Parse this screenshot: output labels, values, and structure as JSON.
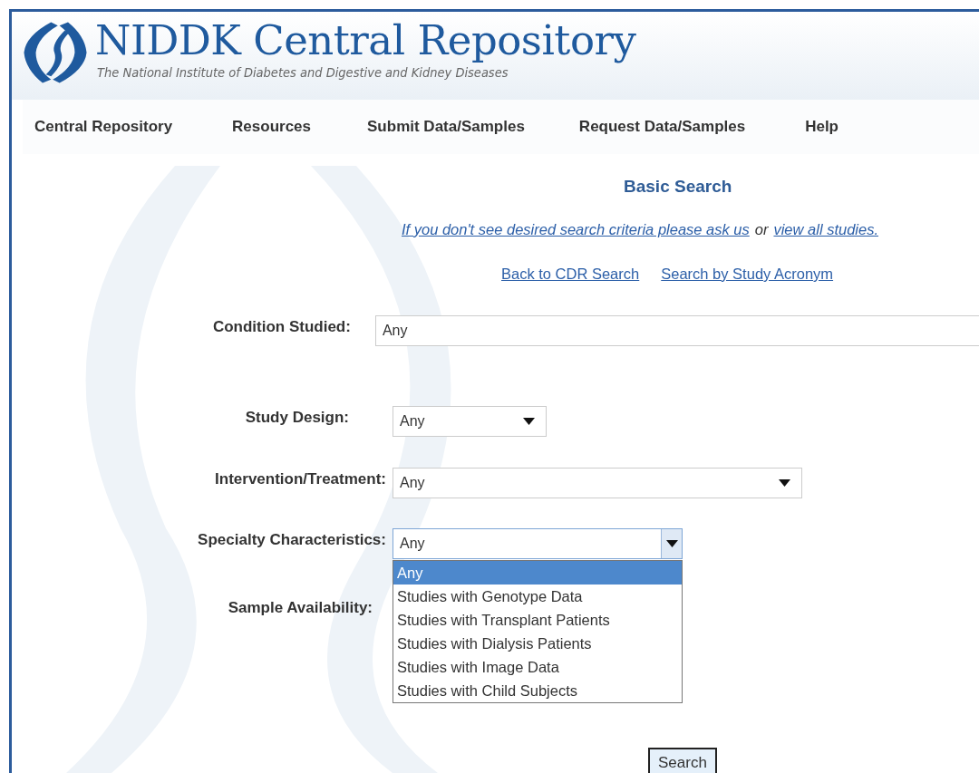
{
  "header": {
    "title": "NIDDK Central Repository",
    "subtitle": "The National Institute of Diabetes and Digestive and Kidney Diseases"
  },
  "nav": [
    {
      "label": "Central Repository"
    },
    {
      "label": "Resources"
    },
    {
      "label": "Submit Data/Samples"
    },
    {
      "label": "Request Data/Samples"
    },
    {
      "label": "Help"
    }
  ],
  "page_title": "Basic Search",
  "help_line": {
    "link_1": "If you don't see desired search criteria please ask us",
    "conjunction": "or",
    "link_2": "view all studies."
  },
  "links": [
    "Back to CDR Search",
    "Search by Study Acronym"
  ],
  "fields": [
    {
      "label": "Condition Studied:",
      "kind": "text",
      "value": "Any"
    },
    {
      "label": "Study Design:",
      "kind": "select",
      "value": "Any",
      "expanded": false
    },
    {
      "label": "Intervention/Treatment:",
      "kind": "select",
      "value": "Any",
      "expanded": false
    },
    {
      "label": "Specialty Characteristics:",
      "kind": "select",
      "value": "Any",
      "expanded": true,
      "options": [
        {
          "label": "Any",
          "selected": true
        },
        {
          "label": "Studies with Genotype Data",
          "selected": false
        },
        {
          "label": "Studies with Transplant Patients",
          "selected": false
        },
        {
          "label": "Studies with Dialysis Patients",
          "selected": false
        },
        {
          "label": "Studies with Image Data",
          "selected": false
        },
        {
          "label": "Studies with Child Subjects",
          "selected": false
        }
      ]
    },
    {
      "label": "Sample Availability:",
      "kind": "none"
    }
  ],
  "search_button": "Search"
}
